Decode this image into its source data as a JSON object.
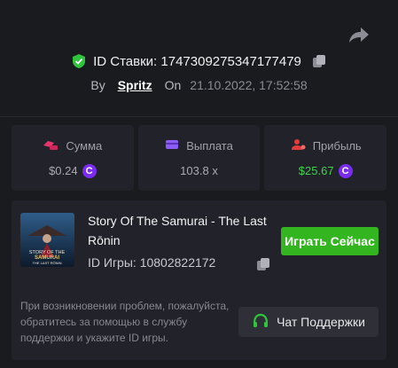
{
  "header": {
    "bet_id_label": "ID Ставки:",
    "bet_id": "1747309275347177479",
    "by_label": "By",
    "username": "Spritz",
    "on_label": "On",
    "datetime": "21.10.2022, 17:52:58"
  },
  "stats": [
    {
      "label": "Сумма",
      "value": "$0.24",
      "icon": "coins-icon",
      "coin": true
    },
    {
      "label": "Выплата",
      "value": "103.8 x",
      "icon": "wallet-icon",
      "coin": false
    },
    {
      "label": "Прибыль",
      "value": "$25.67",
      "icon": "profit-icon",
      "coin": true
    }
  ],
  "game": {
    "title": "Story Of The Samurai - The Last Rōnin",
    "id_label": "ID Игры:",
    "id": "10802822172",
    "play_label": "Играть Сейчас",
    "thumb_line1": "STORY OF THE",
    "thumb_line2": "SAMURAI",
    "thumb_line3": "THE LAST RŌNIN"
  },
  "support": {
    "help_text": "При возникновении проблем, пожалуйста, обратитесь за помощью в службу поддержки и укажите ID игры.",
    "button_label": "Чат Поддержки"
  },
  "colors": {
    "background": "#1a1b1f",
    "panel": "#22232a",
    "accent_green": "#33b51f",
    "profit_green": "#3fd34a",
    "coin_purple": "#7a2cf0",
    "icon_pink": "#e8356d",
    "icon_purple": "#8b5cf6",
    "icon_red": "#e23b3b"
  }
}
